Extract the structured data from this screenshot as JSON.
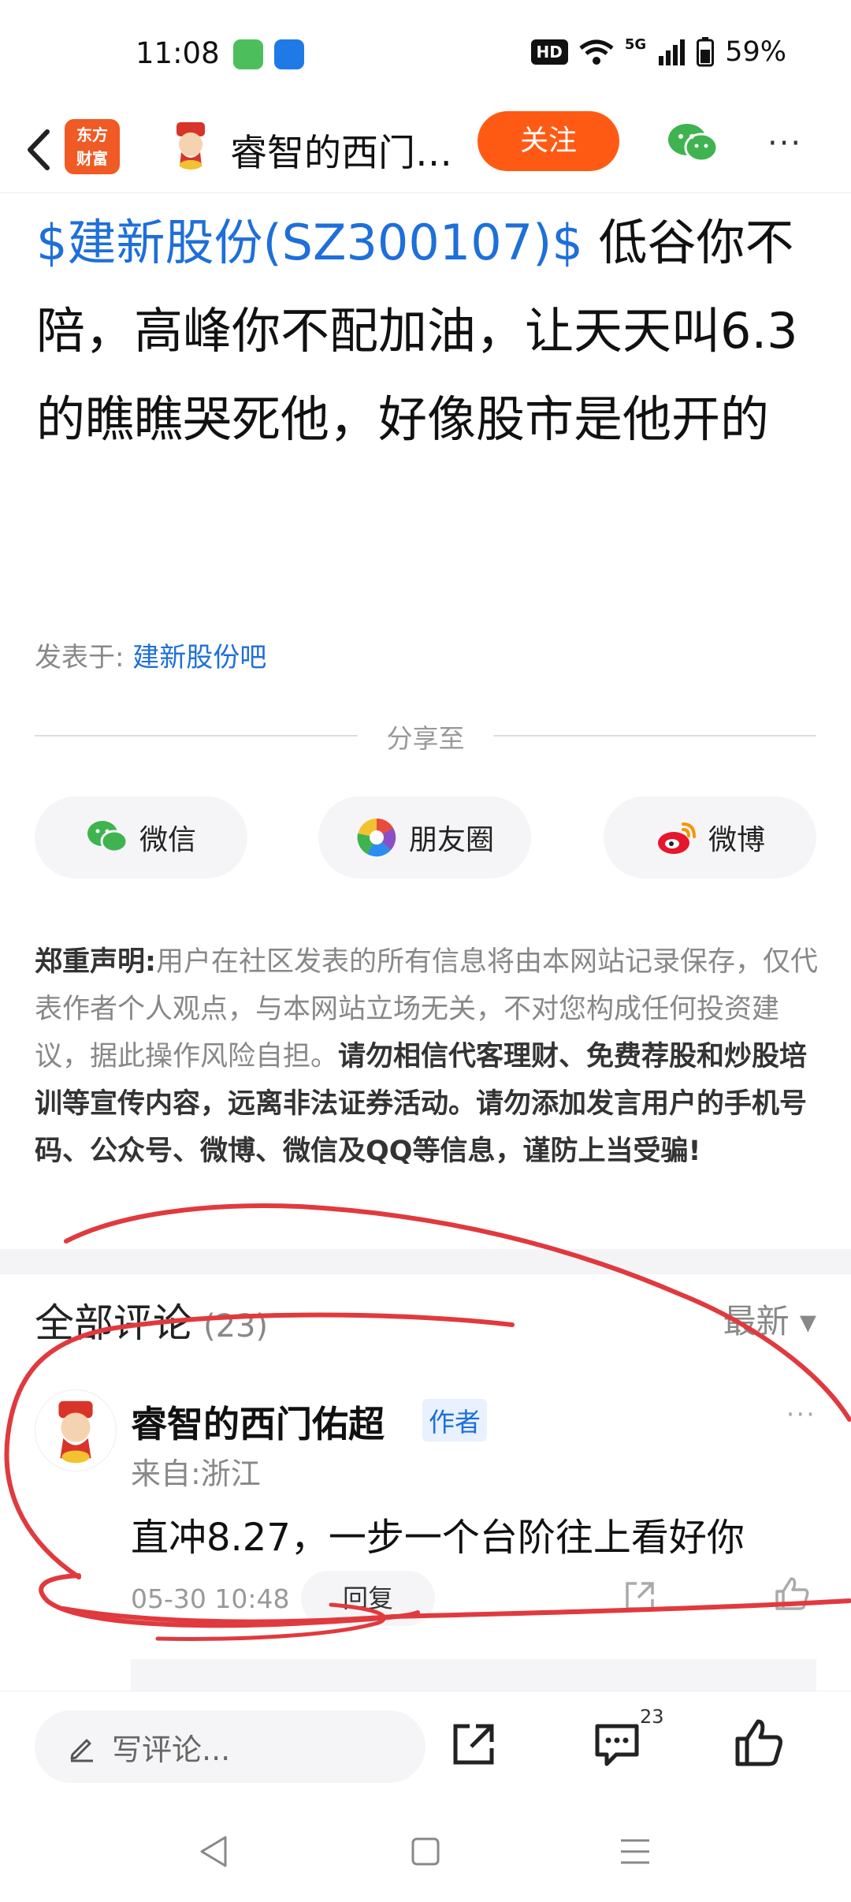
{
  "status_bar": {
    "time": "11:08",
    "hd": "HD",
    "network": "5G",
    "battery": "59%"
  },
  "header": {
    "brand_line1": "东方",
    "brand_line2": "财富",
    "title": "睿智的西门…",
    "follow_label": "关注",
    "more_label": "···"
  },
  "post": {
    "stock_tag": "$建新股份(SZ300107)$",
    "text": " 低谷你不陪，高峰你不配加油，让天天叫6.3的瞧瞧哭死他，好像股市是他开的",
    "source_prefix": "发表于: ",
    "source_link": "建新股份吧"
  },
  "share": {
    "title": "分享至",
    "wechat": "微信",
    "moments": "朋友圈",
    "weibo": "微博"
  },
  "disclaimer": {
    "heading": "郑重声明:",
    "normal": "用户在社区发表的所有信息将由本网站记录保存，仅代表作者个人观点，与本网站立场无关，不对您构成任何投资建议，据此操作风险自担。",
    "bold": "请勿相信代客理财、免费荐股和炒股培训等宣传内容，远离非法证券活动。请勿添加发言用户的手机号码、公众号、微博、微信及QQ等信息，谨防上当受骗!"
  },
  "comments": {
    "title": "全部评论",
    "count": "(23)",
    "sort": "最新 ▾",
    "items": [
      {
        "name": "睿智的西门佑超",
        "tag": "作者",
        "from": "来自:浙江",
        "text": "直冲8.27，一步一个台阶往上看好你",
        "time": "05-30 10:48",
        "reply_label": "回复",
        "more": "···"
      }
    ]
  },
  "bottom_bar": {
    "placeholder": "写评论...",
    "comment_count": "23"
  },
  "colors": {
    "accent_orange": "#ff5a14",
    "link_blue": "#1e6fd9",
    "annotation_red": "#e03a3e"
  }
}
